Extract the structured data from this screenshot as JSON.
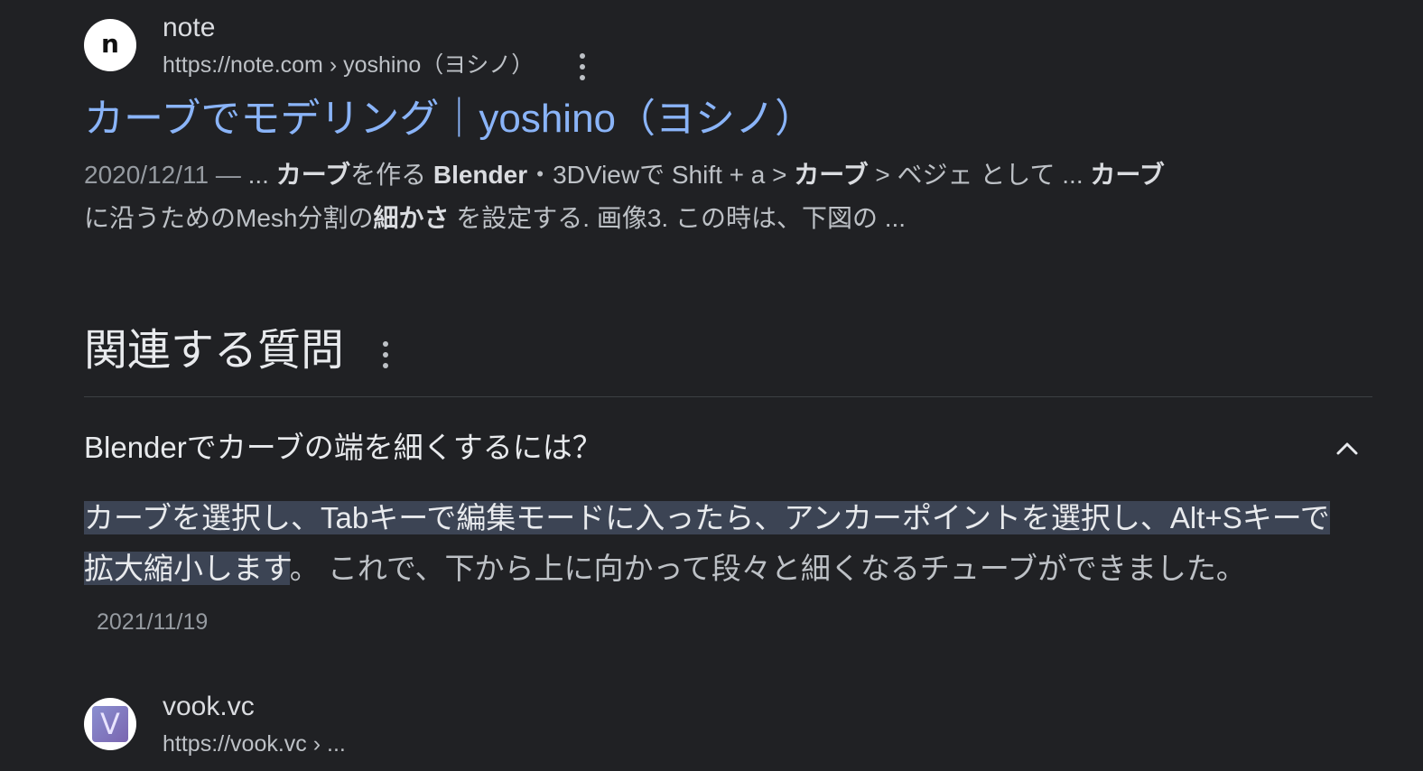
{
  "result1": {
    "favicon_letter": "n",
    "site_name": "note",
    "site_url": "https://note.com › yoshino（ヨシノ）",
    "title": "カーブでモデリング｜yoshino（ヨシノ）",
    "snippet": {
      "date": "2020/12/11 — ",
      "s1": "... ",
      "b1": "カーブ",
      "s2": "を作る ",
      "b2": "Blender",
      "s3": "・3DViewで Shift + a > ",
      "b3": "カーブ",
      "s4": " > ベジェ として ... ",
      "b4": "カーブ",
      "s5": " に沿うためのMesh分割の",
      "b5": "細かさ",
      "s6": " を設定する. 画像3. この時は、下図の ..."
    }
  },
  "related_questions": {
    "heading": "関連する質問",
    "items": [
      {
        "question": "Blenderでカーブの端を細くするには？",
        "answer_highlight": "カーブを選択し、Tabキーで編集モードに入ったら、アンカーポイントを選択し、Alt+Sキーで拡大縮小します",
        "answer_rest": "。 これで、下から上に向かって段々と細くなるチューブができました。",
        "answer_date": "2021/11/19",
        "expanded": true
      }
    ]
  },
  "result2": {
    "favicon_letter": "V",
    "site_name": "vook.vc",
    "site_url": "https://vook.vc › ..."
  },
  "colors": {
    "background": "#202124",
    "link": "#8ab4f8",
    "text": "#bdc1c6",
    "heading": "#e8eaed",
    "highlight": "#3c4454"
  }
}
